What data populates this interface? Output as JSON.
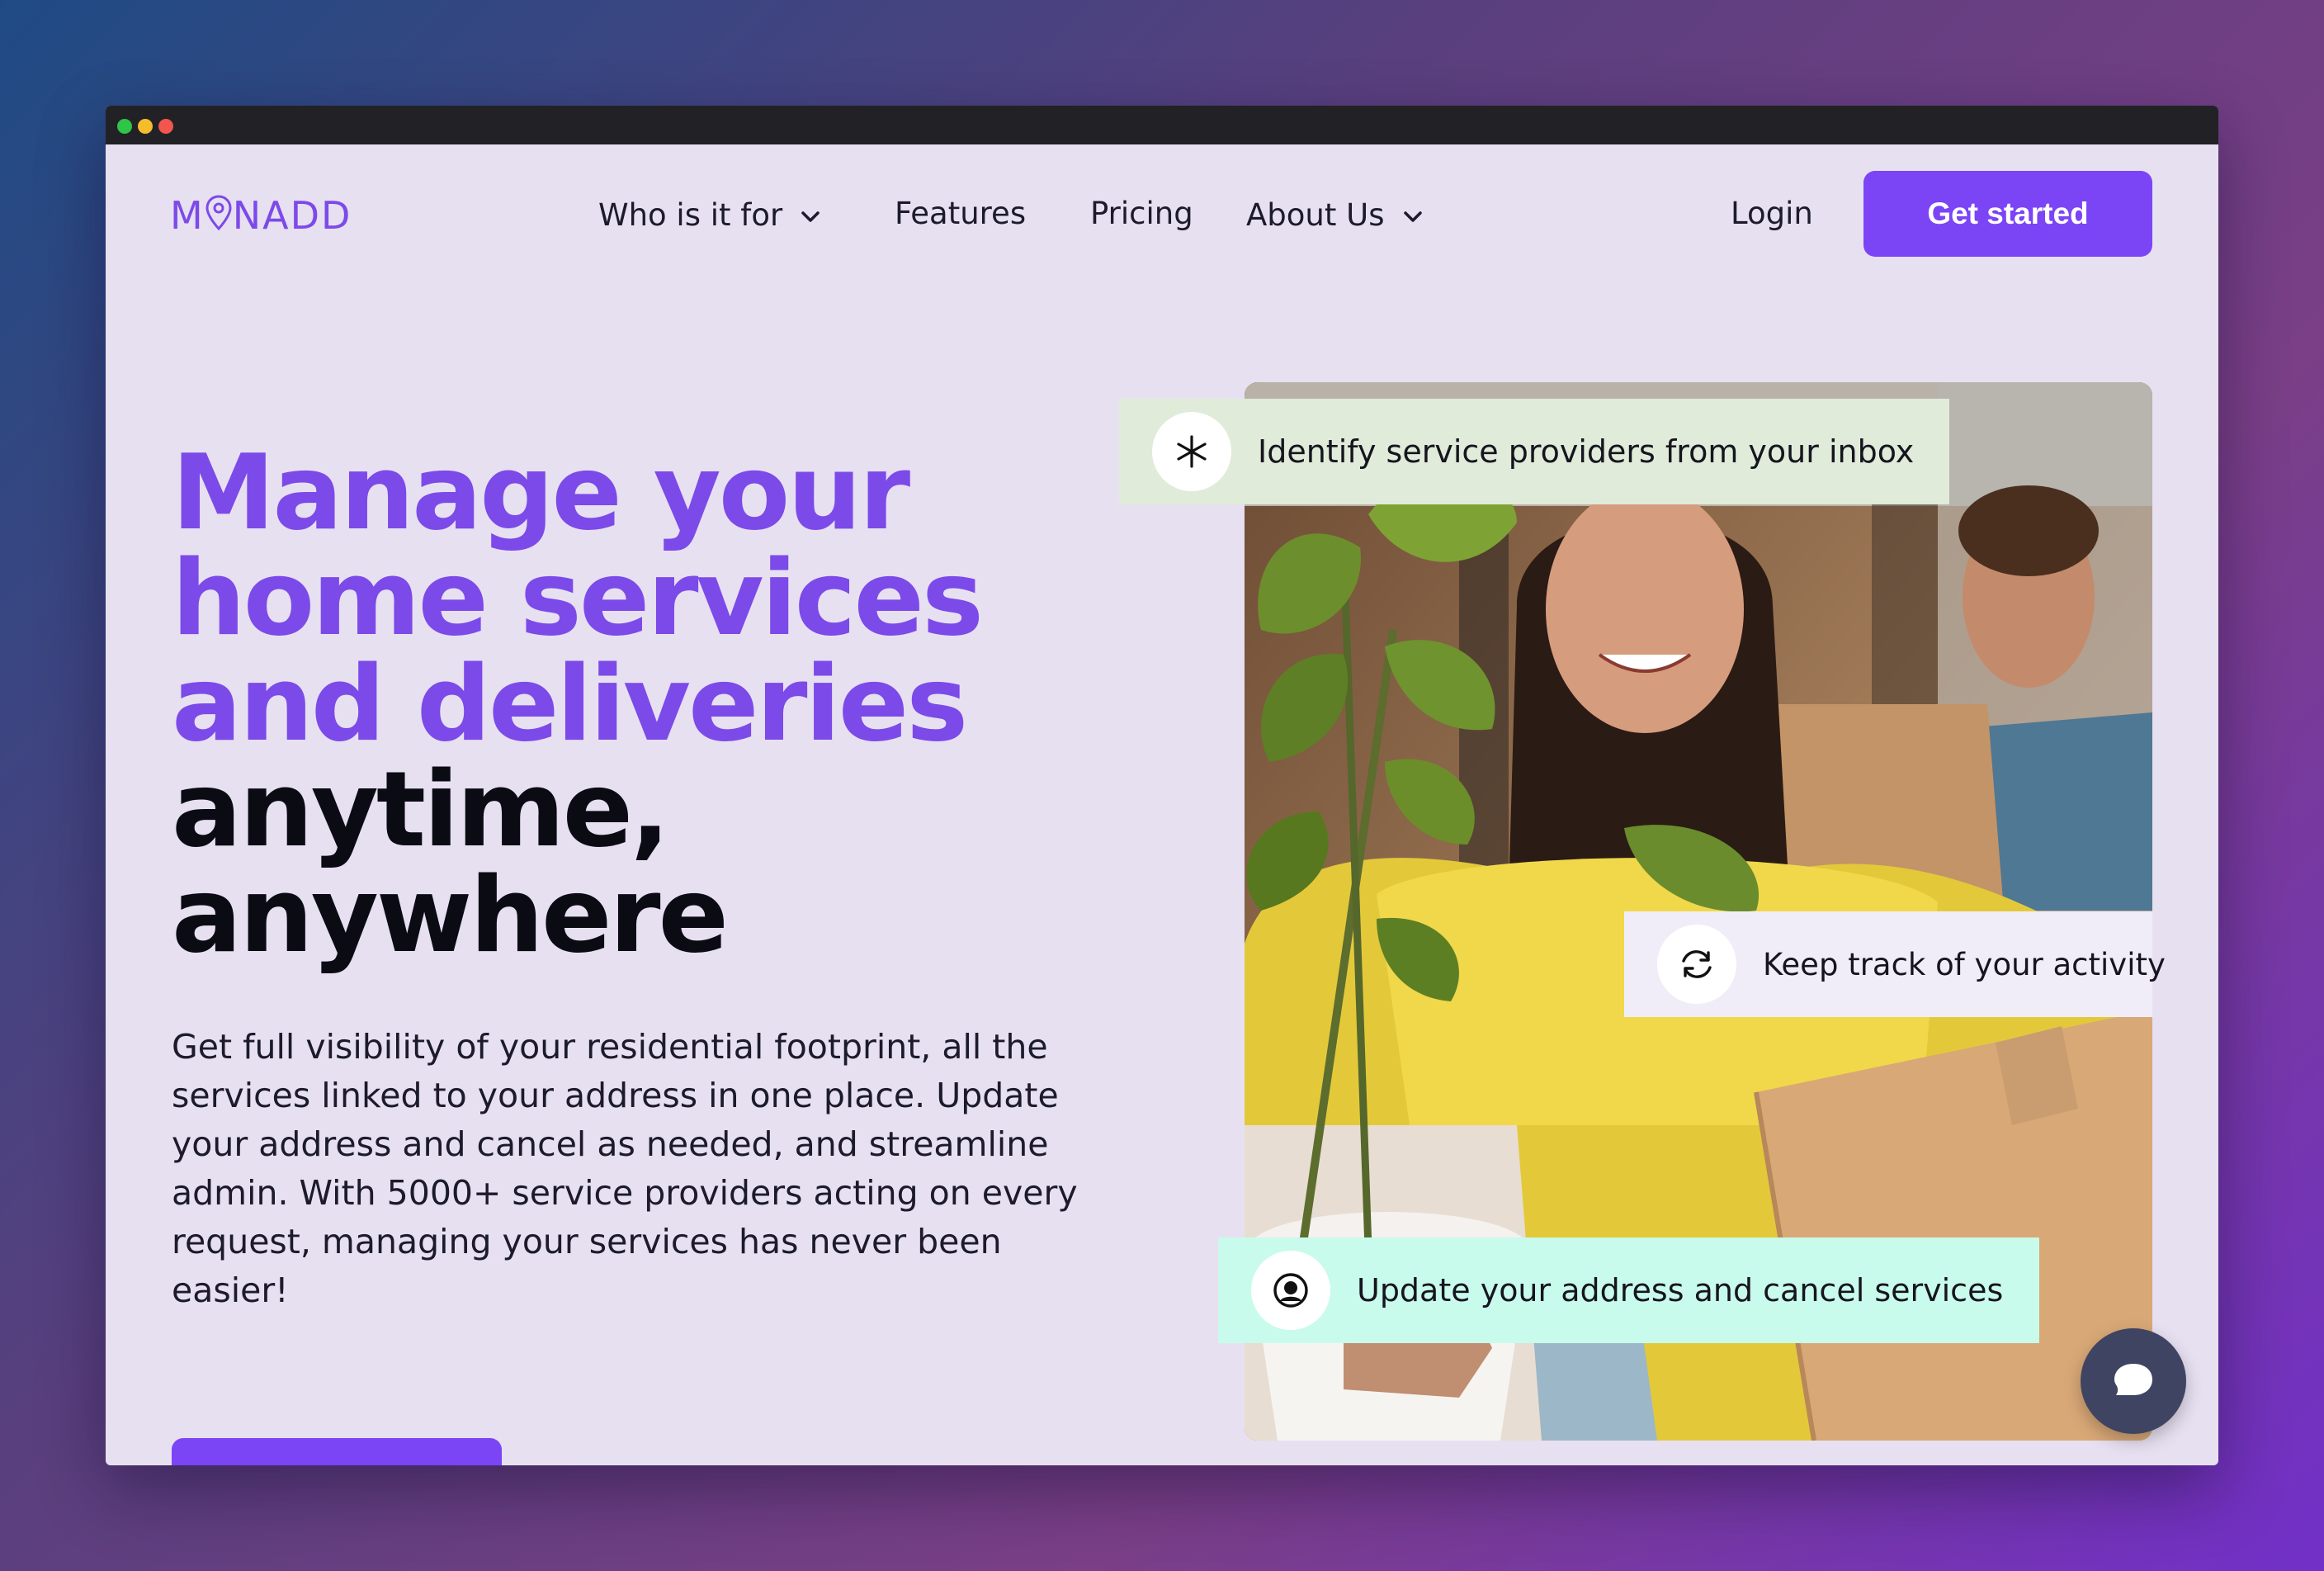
{
  "brand": {
    "logo_text": "MONADD",
    "accent_color": "#7b44f5",
    "headline_color": "#7c4ae8"
  },
  "nav": {
    "items": [
      {
        "label": "Who is it for",
        "has_dropdown": true
      },
      {
        "label": "Features",
        "has_dropdown": false
      },
      {
        "label": "Pricing",
        "has_dropdown": false
      },
      {
        "label": "About Us",
        "has_dropdown": true
      }
    ],
    "login_label": "Login",
    "cta_label": "Get started"
  },
  "hero": {
    "headline_purple": [
      "Manage your",
      "home services",
      "and deliveries"
    ],
    "headline_black": [
      "anytime,",
      "anywhere"
    ],
    "description": "Get full visibility of your residential footprint, all the services linked to your address in one place. Update your address and cancel as needed, and streamline  admin. With 5000+ service providers acting on every request, managing your services has never been easier!"
  },
  "features": [
    {
      "icon": "asterisk-icon",
      "text": "Identify service providers from your inbox",
      "bg": "#e0ebd9"
    },
    {
      "icon": "refresh-icon",
      "text": "Keep track of your activity",
      "bg": "#f1edf8"
    },
    {
      "icon": "user-circle-icon",
      "text": "Update your address and cancel services",
      "bg": "#c8fbeb"
    }
  ],
  "chat_widget": {
    "icon": "chat-bubble-icon"
  }
}
